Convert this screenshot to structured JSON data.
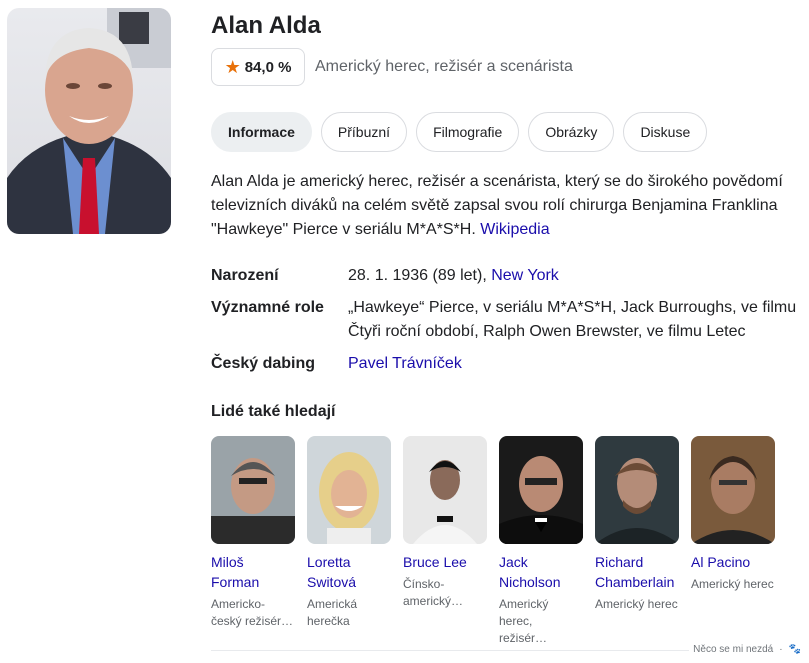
{
  "header": {
    "title": "Alan Alda",
    "rating": "84,0 %",
    "rating_icon": "star-icon",
    "subtitle": "Americký herec, režisér a scenárista"
  },
  "tabs": [
    {
      "label": "Informace",
      "active": true
    },
    {
      "label": "Příbuzní"
    },
    {
      "label": "Filmografie"
    },
    {
      "label": "Obrázky"
    },
    {
      "label": "Diskuse"
    }
  ],
  "description": {
    "text": "Alan Alda je americký herec, režisér a scenárista, který se do širokého povědomí televizních diváků na celém světě zapsal svou rolí chirurga Benjamina Franklina \"Hawkeye\" Pierce v seriálu M*A*S*H. ",
    "source": "Wikipedia"
  },
  "facts": {
    "birth": {
      "label": "Narození",
      "value": "28. 1. 1936 (89 let), ",
      "link": "New York"
    },
    "roles": {
      "label": "Významné role",
      "value": "„Hawkeye“ Pierce, v seriálu M*A*S*H, Jack Burroughs, ve filmu Čtyři roční období, Ralph Owen Brewster, ve filmu Letec"
    },
    "dubbing": {
      "label": "Český dabing",
      "link": "Pavel Trávníček"
    }
  },
  "related": {
    "title": "Lidé také hledají",
    "people": [
      {
        "name": "Miloš Forman",
        "desc": "Americko-český režisér…"
      },
      {
        "name": "Loretta Switová",
        "desc": "Americká herečka"
      },
      {
        "name": "Bruce Lee",
        "desc": "Čínsko-americký…"
      },
      {
        "name": "Jack Nicholson",
        "desc": "Americký herec, režisér…"
      },
      {
        "name": "Richard Chamberlain",
        "desc": "Americký herec"
      },
      {
        "name": "Al Pacino",
        "desc": "Americký herec"
      }
    ]
  },
  "footer": {
    "feedback": "Něco se mi nezdá"
  },
  "colors": {
    "accent_link": "#1a0dab",
    "star": "#e8710a",
    "active_tab": "#eceff1"
  }
}
